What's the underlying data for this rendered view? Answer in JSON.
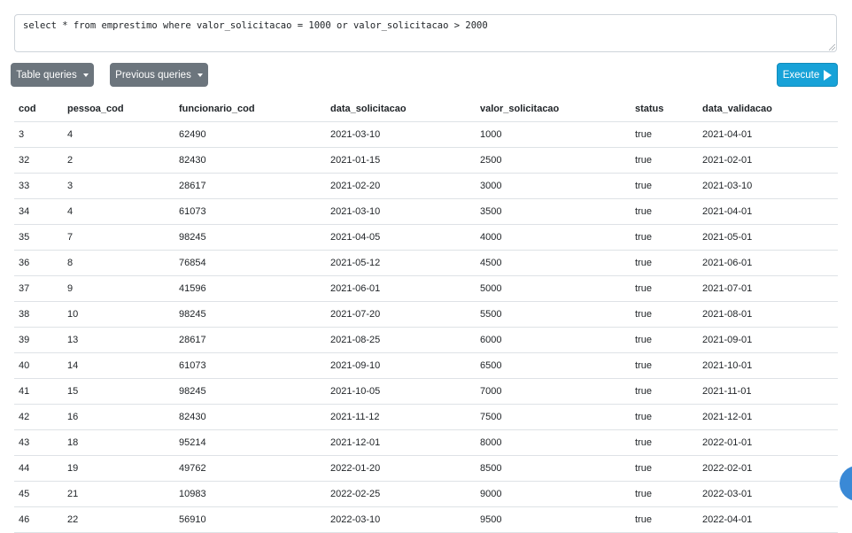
{
  "query": {
    "text": "select * from emprestimo where valor_solicitacao = 1000 or valor_solicitacao > 2000"
  },
  "toolbar": {
    "table_queries_label": "Table queries",
    "previous_queries_label": "Previous queries",
    "execute_label": "Execute",
    "icons": {
      "dropdown": "caret-down-icon",
      "execute": "play-icon"
    }
  },
  "results": {
    "columns": [
      "cod",
      "pessoa_cod",
      "funcionario_cod",
      "data_solicitacao",
      "valor_solicitacao",
      "status",
      "data_validacao"
    ],
    "rows": [
      [
        "3",
        "4",
        "62490",
        "2021-03-10",
        "1000",
        "true",
        "2021-04-01"
      ],
      [
        "32",
        "2",
        "82430",
        "2021-01-15",
        "2500",
        "true",
        "2021-02-01"
      ],
      [
        "33",
        "3",
        "28617",
        "2021-02-20",
        "3000",
        "true",
        "2021-03-10"
      ],
      [
        "34",
        "4",
        "61073",
        "2021-03-10",
        "3500",
        "true",
        "2021-04-01"
      ],
      [
        "35",
        "7",
        "98245",
        "2021-04-05",
        "4000",
        "true",
        "2021-05-01"
      ],
      [
        "36",
        "8",
        "76854",
        "2021-05-12",
        "4500",
        "true",
        "2021-06-01"
      ],
      [
        "37",
        "9",
        "41596",
        "2021-06-01",
        "5000",
        "true",
        "2021-07-01"
      ],
      [
        "38",
        "10",
        "98245",
        "2021-07-20",
        "5500",
        "true",
        "2021-08-01"
      ],
      [
        "39",
        "13",
        "28617",
        "2021-08-25",
        "6000",
        "true",
        "2021-09-01"
      ],
      [
        "40",
        "14",
        "61073",
        "2021-09-10",
        "6500",
        "true",
        "2021-10-01"
      ],
      [
        "41",
        "15",
        "98245",
        "2021-10-05",
        "7000",
        "true",
        "2021-11-01"
      ],
      [
        "42",
        "16",
        "82430",
        "2021-11-12",
        "7500",
        "true",
        "2021-12-01"
      ],
      [
        "43",
        "18",
        "95214",
        "2021-12-01",
        "8000",
        "true",
        "2022-01-01"
      ],
      [
        "44",
        "19",
        "49762",
        "2022-01-20",
        "8500",
        "true",
        "2022-02-01"
      ],
      [
        "45",
        "21",
        "10983",
        "2022-02-25",
        "9000",
        "true",
        "2022-03-01"
      ],
      [
        "46",
        "22",
        "56910",
        "2022-03-10",
        "9500",
        "true",
        "2022-04-01"
      ]
    ]
  },
  "colors": {
    "secondary_button": "#6c757d",
    "execute_button": "#17a2d8",
    "floating_button": "#3a89d6",
    "table_border": "#dee2e6"
  }
}
